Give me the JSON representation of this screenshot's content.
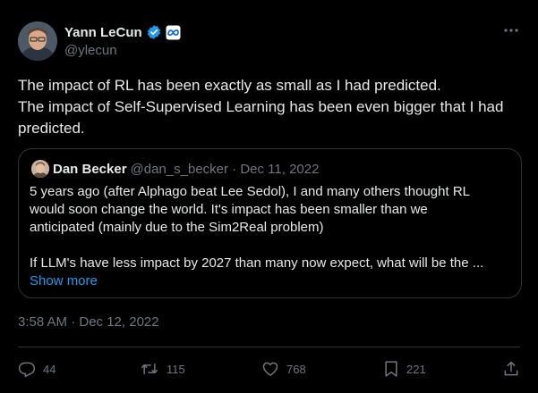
{
  "author": {
    "display_name": "Yann LeCun",
    "handle": "@ylecun",
    "verified_color": "#1d9bf0",
    "affiliation_icon": "meta-logo-icon"
  },
  "tweet": {
    "lines": [
      "The impact of RL has been exactly as small as I had predicted.",
      "The impact of Self-Supervised Learning has been even bigger that I had",
      "predicted."
    ],
    "timestamp": "3:58 AM · Dec 12, 2022"
  },
  "quote": {
    "display_name": "Dan Becker",
    "meta": "@dan_s_becker · Dec 11, 2022",
    "lines": [
      "5 years ago (after Alphago beat Lee Sedol), I and many others thought RL",
      "would soon change the world. It's impact has been smaller than we",
      "anticipated (mainly due to the Sim2Real problem)",
      "",
      "If LLM's have less impact by 2027 than many now expect, what will be the ..."
    ],
    "show_more": "Show more"
  },
  "actions": {
    "replies": "44",
    "retweets": "115",
    "likes": "768",
    "bookmarks": "221"
  },
  "colors": {
    "background": "#000000",
    "text": "#e7e9ea",
    "muted": "#71767b",
    "accent": "#1d9bf0",
    "border": "#2f3336"
  }
}
